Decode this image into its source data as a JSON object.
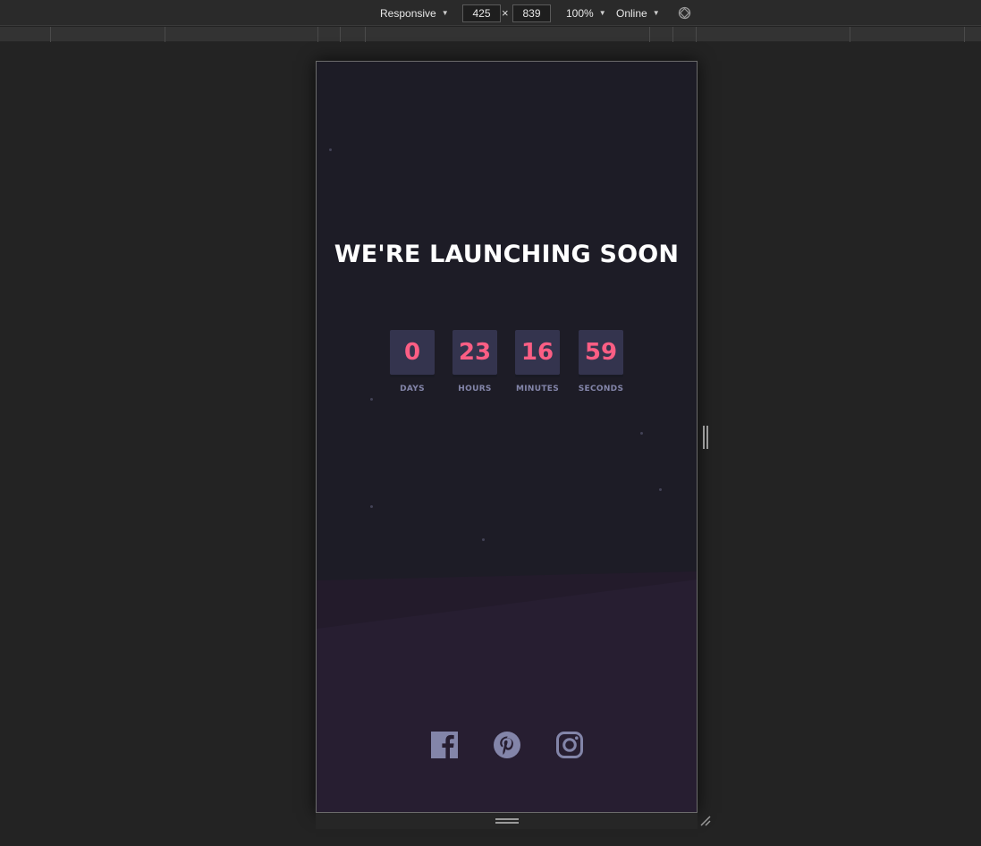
{
  "devtools": {
    "device_mode": "Responsive",
    "width": "425",
    "height": "839",
    "times_sign": "×",
    "zoom": "100%",
    "network": "Online",
    "icons": [
      "chevron-down-icon",
      "rotate-icon"
    ]
  },
  "page": {
    "title": "WE'RE LAUNCHING SOON",
    "countdown": [
      {
        "value": "0",
        "label": "DAYS"
      },
      {
        "value": "23",
        "label": "HOURS"
      },
      {
        "value": "16",
        "label": "MINUTES"
      },
      {
        "value": "59",
        "label": "SECONDS"
      }
    ],
    "social_icons": [
      "facebook-icon",
      "pinterest-icon",
      "instagram-icon"
    ]
  },
  "colors": {
    "background": "#1d1c26",
    "footer_background": "#271e31",
    "card": "#34344e",
    "accent": "#fb5e84",
    "label": "#8385a9",
    "social": "#8385a9",
    "title": "#ffffff"
  }
}
